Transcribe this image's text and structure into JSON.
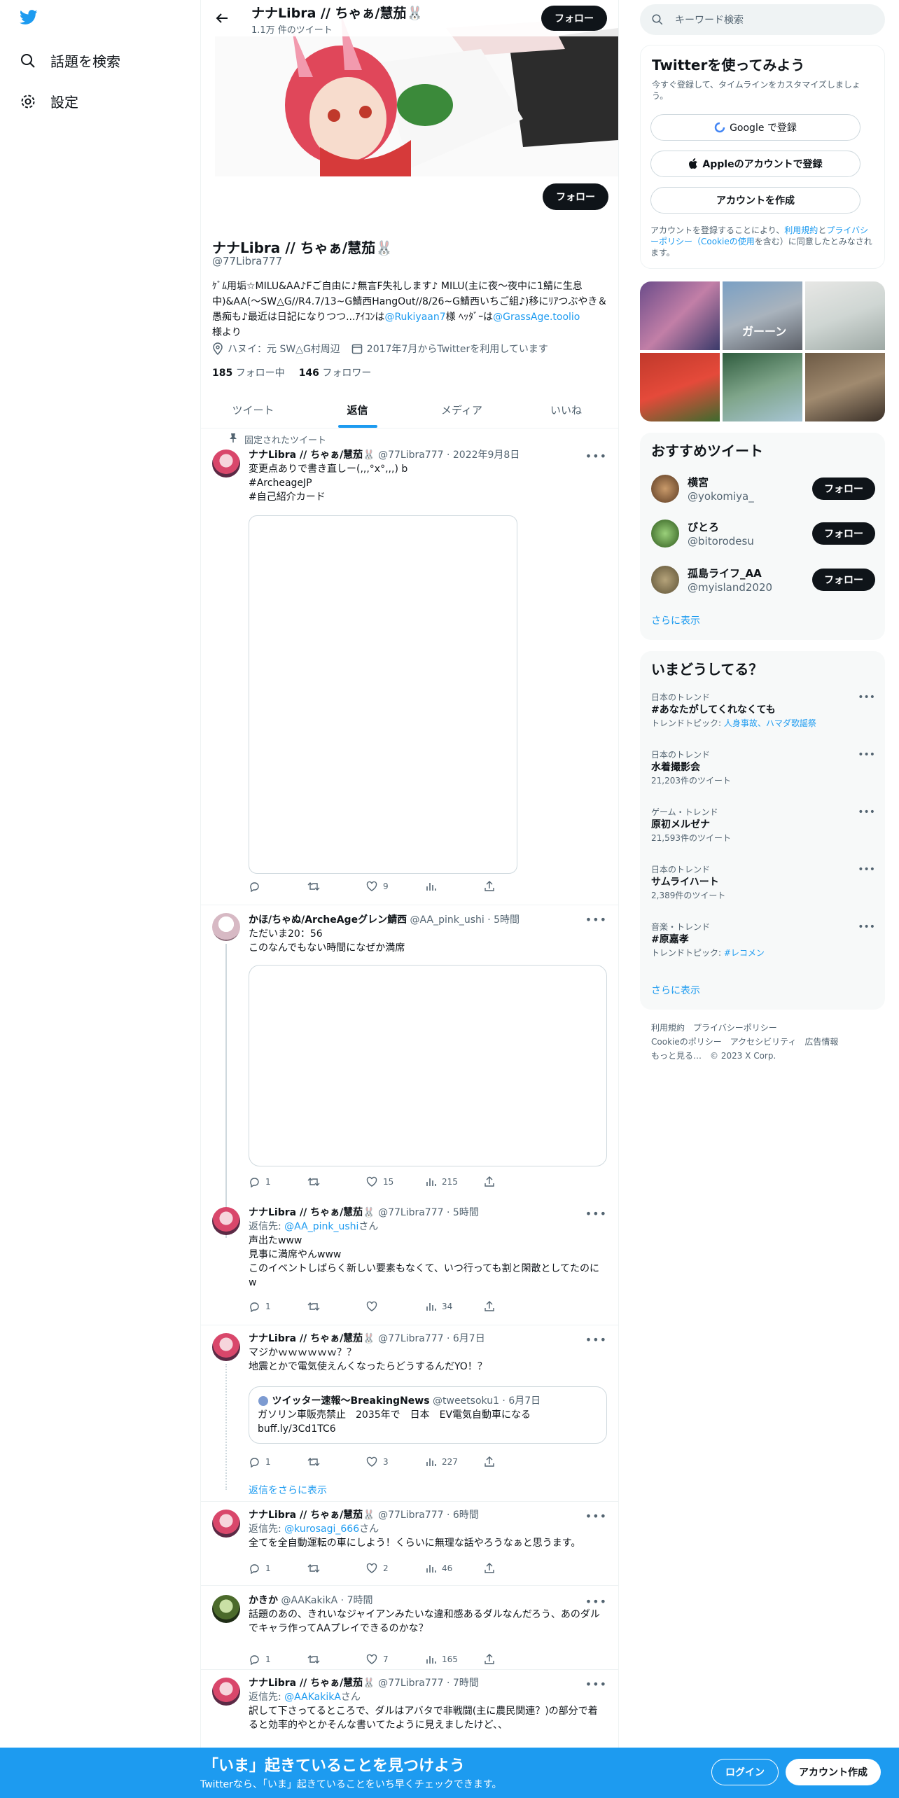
{
  "nav": {
    "search_label": "話題を検索",
    "settings_label": "設定"
  },
  "header": {
    "name": "ナナLibra // ちゃぁ/慧茄🐰",
    "tweet_count": "1.1万 件のツイート",
    "follow": "フォロー"
  },
  "profile": {
    "follow": "フォロー",
    "name": "ナナLibra // ちゃぁ/慧茄🐰",
    "handle": "@77Libra777",
    "bio_1": "ｹﾞﾑ用垢☆MILU&AA♪Fご自由に♪無言F失礼します♪ MILU(主に夜〜夜中に1鯖に生息中)&AA(〜SW△G//R4.7/13~G鯖西HangOut//8/26~G鯖西いちご組♪)移にﾘｱつぶやき＆愚痴も♪最近は日記になりつつ...ｱｲｺﾝは",
    "bio_link1": "@Rukiyaan7",
    "bio_2": "様 ﾍｯﾀﾞｰは",
    "bio_link2": "@GrassAge.toolio",
    "bio_3": "様より",
    "location": "ハヌイ：元 SW△G村周辺",
    "joined": "2017年7月からTwitterを利用しています",
    "following_count": "185",
    "following_label": "フォロー中",
    "followers_count": "146",
    "followers_label": "フォロワー"
  },
  "tabs": [
    "ツイート",
    "返信",
    "メディア",
    "いいね"
  ],
  "tweets": {
    "pinned_label": "固定されたツイート",
    "t1": {
      "name": "ナナLibra // ちゃぁ/慧茄🐰",
      "handle": "@77Libra777",
      "date": "2022年9月8日",
      "text": "変更点ありで書き直しー(,,,°x°,,,) b",
      "tag1": "#ArcheageJP",
      "tag2": "#自己紹介カード",
      "reply": "",
      "retweet": "",
      "like": "9",
      "views": ""
    },
    "t2": {
      "name": "かほ/ちゃぬ/ArcheAgeグレン鯖西",
      "handle": "@AA_pink_ushi",
      "date": "5時間",
      "text1": "ただいま20：56",
      "text2": "このなんでもない時間になぜか満席",
      "reply": "1",
      "retweet": "",
      "like": "15",
      "views": "215"
    },
    "t3": {
      "name": "ナナLibra // ちゃぁ/慧茄🐰",
      "handle": "@77Libra777",
      "date": "5時間",
      "reply_to": "返信先: ",
      "reply_handle": "@AA_pink_ushi",
      "reply_suffix": "さん",
      "text1": "声出たwww",
      "text2": "見事に満席やんwww",
      "text3": "このイベントしばらく新しい要素もなくて、いつ行っても割と閑散としてたのにw",
      "reply": "1",
      "retweet": "",
      "like": "",
      "views": "34"
    },
    "t4": {
      "name": "ナナLibra // ちゃぁ/慧茄🐰",
      "handle": "@77Libra777",
      "date": "6月7日",
      "text1": "マジかｗｗｗｗｗｗ？？",
      "text2": "地震とかで電気使えんくなったらどうするんだYO！？",
      "q_name": "ツイッター速報〜BreakingNews",
      "q_handle": "@tweetsoku1",
      "q_date": "6月7日",
      "q_text1": "ガソリン車販売禁止　2035年で　日本　EV電気自動車になる",
      "q_text2": "buff.ly/3Cd1TC6",
      "reply": "1",
      "retweet": "",
      "like": "3",
      "views": "227"
    },
    "show_more": "返信をさらに表示",
    "t5": {
      "name": "ナナLibra // ちゃぁ/慧茄🐰",
      "handle": "@77Libra777",
      "date": "6時間",
      "reply_to": "返信先: ",
      "reply_handle": "@kurosagi_666",
      "reply_suffix": "さん",
      "text": "全てを全自動運転の車にしよう！くらいに無理な話やろうなぁと思うます。",
      "reply": "1",
      "retweet": "",
      "like": "2",
      "views": "46"
    },
    "t6": {
      "name": "かきか",
      "handle": "@AAKakikA",
      "date": "7時間",
      "text": "話題のあの、きれいなジャイアンみたいな違和感あるダルなんだろう、あのダルでキャラ作ってAAプレイできるのかな？",
      "reply": "1",
      "retweet": "",
      "like": "7",
      "views": "165"
    },
    "t7": {
      "name": "ナナLibra // ちゃぁ/慧茄🐰",
      "handle": "@77Libra777",
      "date": "7時間",
      "reply_to": "返信先: ",
      "reply_handle": "@AAKakikA",
      "reply_suffix": "さん",
      "text": "訳して下さってるところで、ダルはアバタで非戦闘(主に農民関連？)の部分で着ると効率的やとかそんな書いてたように見えましたけど、、"
    }
  },
  "right": {
    "search_placeholder": "キーワード検索",
    "signup": {
      "title": "Twitterを使ってみよう",
      "sub": "今すぐ登録して、タイムラインをカスタマイズしましょう。",
      "google": "Google で登録",
      "apple": "Appleのアカウントで登録",
      "create": "アカウントを作成",
      "legal_1": "アカウントを登録することにより、",
      "legal_terms": "利用規約",
      "legal_2": "と",
      "legal_privacy": "プライバシーポリシー（Cookieの使用",
      "legal_3": "を含む）に同意したとみなされます。"
    },
    "recommend": {
      "title": "おすすめツイート",
      "users": [
        {
          "name": "横宮",
          "handle": "@yokomiya_",
          "follow": "フォロー"
        },
        {
          "name": "びとろ",
          "handle": "@bitorodesu",
          "follow": "フォロー"
        },
        {
          "name": "孤島ライフ_AA",
          "handle": "@myisland2020",
          "follow": "フォロー"
        }
      ],
      "more": "さらに表示"
    },
    "trends": {
      "title": "いまどうしてる？",
      "items": [
        {
          "cat": "日本のトレンド",
          "name": "#あなたがしてくれなくても",
          "sub_label": "トレンドトピック: ",
          "sub_link": "人身事故、ハマダ歌謡祭"
        },
        {
          "cat": "日本のトレンド",
          "name": "水着撮影会",
          "sub": "21,203件のツイート"
        },
        {
          "cat": "ゲーム・トレンド",
          "name": "原初メルゼナ",
          "sub": "21,593件のツイート"
        },
        {
          "cat": "日本のトレンド",
          "name": "サムライハート",
          "sub": "2,389件のツイート"
        },
        {
          "cat": "音楽・トレンド",
          "name": "#原嘉孝",
          "sub_label": "トレンドトピック: ",
          "sub_link": "#レコメン"
        }
      ],
      "more": "さらに表示"
    },
    "footer": {
      "l1": "利用規約　プライバシーポリシー",
      "l2": "Cookieのポリシー　アクセシビリティ　広告情報",
      "l3": "もっと見る…　© 2023 X Corp."
    },
    "photo_caption": "ガーーン"
  },
  "bottom": {
    "title": "「いま」起きていることを見つけよう",
    "sub": "Twitterなら、「いま」起きていることをいち早くチェックできます。",
    "login": "ログイン",
    "signup": "アカウント作成"
  },
  "colors": {
    "accent": "#1d9bf0",
    "text": "#0f1419",
    "muted": "#536471"
  }
}
